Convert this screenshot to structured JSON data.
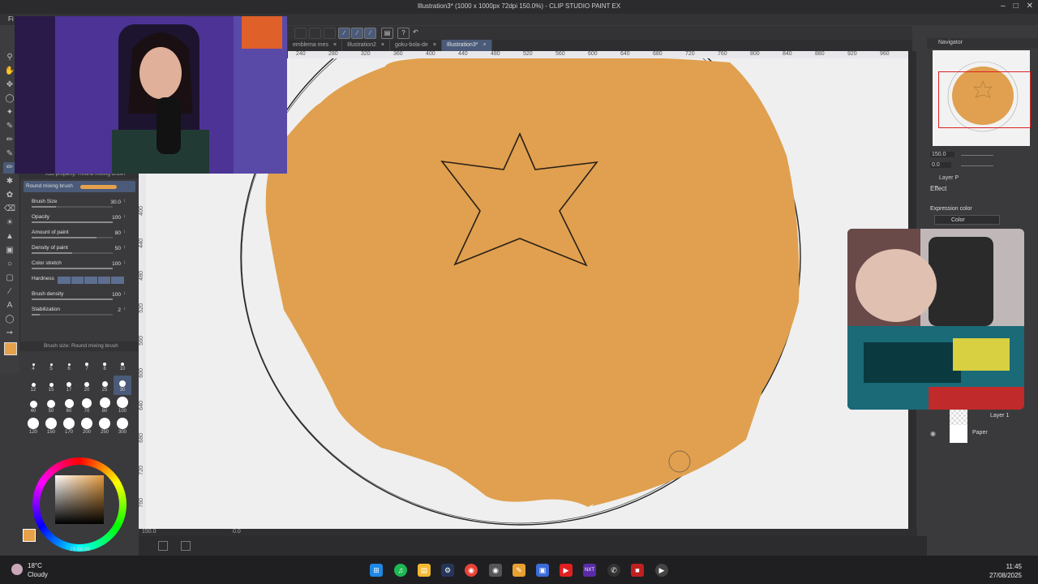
{
  "window": {
    "title": "Illustration3* (1000 x 1000px 72dpi 150.0%) - CLIP STUDIO PAINT EX"
  },
  "menubar": {
    "first_item": "Fi"
  },
  "tabs": [
    {
      "label": "emblema mes",
      "active": false
    },
    {
      "label": "Illustration2",
      "active": false
    },
    {
      "label": "goku-bola-de",
      "active": false
    },
    {
      "label": "Illustration3*",
      "active": true
    }
  ],
  "ruler_top": [
    "240",
    "280",
    "320",
    "360",
    "400",
    "440",
    "480",
    "520",
    "560",
    "600",
    "640",
    "680",
    "720",
    "760",
    "800",
    "840",
    "880",
    "920",
    "960"
  ],
  "ruler_left": [
    "400",
    "440",
    "480",
    "520",
    "560",
    "600",
    "640",
    "680",
    "720",
    "760"
  ],
  "tool_property": {
    "header": "Tool property: Round mixing brush",
    "brush_name": "Round mixing brush",
    "rows": [
      {
        "label": "Brush Size",
        "value": "30.0",
        "fill": 0.3
      },
      {
        "label": "Opacity",
        "value": "100",
        "fill": 1.0
      },
      {
        "label": "Amount of paint",
        "value": "80",
        "fill": 0.8
      },
      {
        "label": "Density of paint",
        "value": "50",
        "fill": 0.5
      },
      {
        "label": "Color stretch",
        "value": "100",
        "fill": 1.0
      },
      {
        "label": "Hardness",
        "value": "",
        "fill": 1.0
      },
      {
        "label": "Brush density",
        "value": "100",
        "fill": 1.0
      },
      {
        "label": "Stabilization",
        "value": "2",
        "fill": 0.1
      }
    ]
  },
  "brush_size_panel": {
    "header": "Brush size: Round mixing brush",
    "sizes": [
      "4",
      "5",
      "6",
      "7",
      "8",
      "10",
      "12",
      "15",
      "17",
      "20",
      "25",
      "30",
      "40",
      "50",
      "60",
      "70",
      "80",
      "100",
      "120",
      "150",
      "170",
      "200",
      "250",
      "300"
    ],
    "selected": "30"
  },
  "color": {
    "main": "#e5a24a",
    "values_text": "29 66 89"
  },
  "navigator": {
    "label": "Navigator",
    "zoom": "150.0",
    "rotation": "0.0"
  },
  "layer_panel": {
    "tab_label": "Layer P",
    "effect_label": "Effect",
    "expression_color_label": "Expression color",
    "expression_color_value": "Color",
    "layers": [
      {
        "name": "Layer 1"
      },
      {
        "name": "Paper"
      }
    ]
  },
  "status": {
    "zoom": "150.0",
    "angle": "0.0"
  },
  "taskbar": {
    "weather_temp": "18°C",
    "weather_cond": "Cloudy",
    "time": "11:45",
    "date": "27/08/2025"
  },
  "colors": {
    "paint": "#e0a04f",
    "canvas_bg": "#efefef",
    "accent": "#4a5a78"
  }
}
